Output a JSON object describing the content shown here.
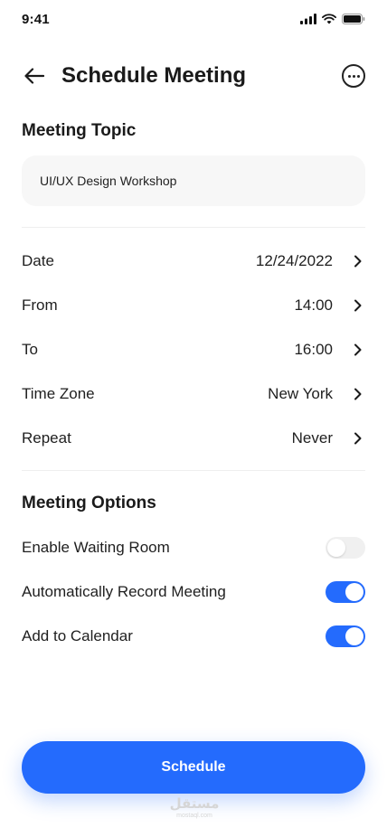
{
  "status_bar": {
    "time": "9:41"
  },
  "header": {
    "title": "Schedule Meeting",
    "back_icon": "arrow-left-icon",
    "more_icon": "more-options-icon"
  },
  "topic": {
    "section_title": "Meeting Topic",
    "value": "UI/UX Design Workshop"
  },
  "settings": [
    {
      "label": "Date",
      "value": "12/24/2022"
    },
    {
      "label": "From",
      "value": "14:00"
    },
    {
      "label": "To",
      "value": "16:00"
    },
    {
      "label": "Time Zone",
      "value": "New York"
    },
    {
      "label": "Repeat",
      "value": "Never"
    }
  ],
  "options": {
    "section_title": "Meeting Options",
    "items": [
      {
        "label": "Enable Waiting Room",
        "enabled": false
      },
      {
        "label": "Automatically Record Meeting",
        "enabled": true
      },
      {
        "label": "Add to Calendar",
        "enabled": true
      }
    ]
  },
  "actions": {
    "schedule_label": "Schedule"
  },
  "watermark": {
    "main": "مستقل",
    "sub": "mostaql.com"
  },
  "colors": {
    "accent": "#246bfd",
    "field_bg": "#f7f7f7",
    "toggle_off": "#f0f0f0"
  }
}
